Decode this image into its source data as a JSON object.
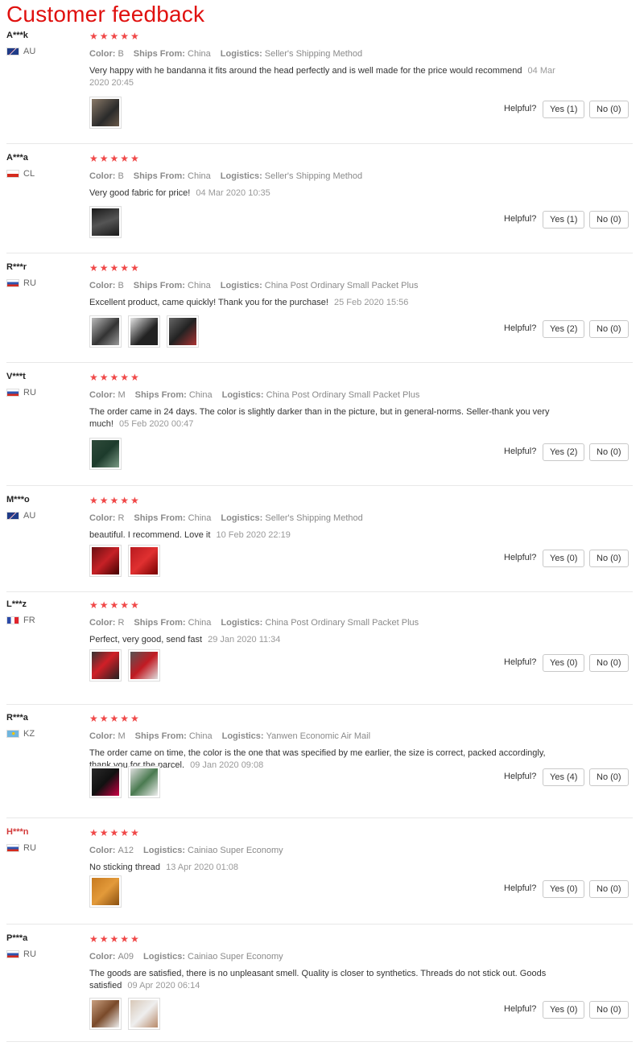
{
  "page_title": "Customer feedback",
  "labels": {
    "color": "Color:",
    "ships_from": "Ships From:",
    "logistics": "Logistics:",
    "helpful": "Helpful?",
    "star_glyphs": "★★★★★"
  },
  "colors": {
    "title": "#e0110f",
    "stars": "#f04848",
    "red_user": "#d33a3a"
  },
  "reviews": [
    {
      "user": "A***k",
      "country": "AU",
      "flag": "au",
      "stars": 5,
      "color": "B",
      "ships_from": "China",
      "logistics": "Seller's Shipping Method",
      "text": "Very happy with he bandanna it fits around the head perfectly and is well made for the price would recommend",
      "date": "04 Mar 2020 20:45",
      "yes": "Yes (1)",
      "no": "No (0)",
      "photos": 1
    },
    {
      "user": "A***a",
      "country": "CL",
      "flag": "cl",
      "stars": 5,
      "color": "B",
      "ships_from": "China",
      "logistics": "Seller's Shipping Method",
      "text": "Very good fabric for price!",
      "date": "04 Mar 2020 10:35",
      "yes": "Yes (1)",
      "no": "No (0)",
      "photos": 1
    },
    {
      "user": "R***r",
      "country": "RU",
      "flag": "ru",
      "stars": 5,
      "color": "B",
      "ships_from": "China",
      "logistics": "China Post Ordinary Small Packet Plus",
      "text": "Excellent product, came quickly! Thank you for the purchase!",
      "date": "25 Feb 2020 15:56",
      "yes": "Yes (2)",
      "no": "No (0)",
      "photos": 3
    },
    {
      "user": "V***t",
      "country": "RU",
      "flag": "ru",
      "stars": 5,
      "color": "M",
      "ships_from": "China",
      "logistics": "China Post Ordinary Small Packet Plus",
      "text": "The order came in 24 days. The color is slightly darker than in the picture, but in general-norms. Seller-thank you very much!",
      "date": "05 Feb 2020 00:47",
      "yes": "Yes (2)",
      "no": "No (0)",
      "photos": 1
    },
    {
      "user": "M***o",
      "country": "AU",
      "flag": "au",
      "stars": 5,
      "color": "R",
      "ships_from": "China",
      "logistics": "Seller's Shipping Method",
      "text": "beautiful. I recommend. Love it",
      "date": "10 Feb 2020 22:19",
      "yes": "Yes (0)",
      "no": "No (0)",
      "photos": 2
    },
    {
      "user": "L***z",
      "country": "FR",
      "flag": "fr",
      "stars": 5,
      "color": "R",
      "ships_from": "China",
      "logistics": "China Post Ordinary Small Packet Plus",
      "text": "Perfect, very good, send fast",
      "date": "29 Jan 2020 11:34",
      "yes": "Yes (0)",
      "no": "No (0)",
      "photos": 2
    },
    {
      "user": "R***a",
      "country": "KZ",
      "flag": "kz",
      "stars": 5,
      "color": "M",
      "ships_from": "China",
      "logistics": "Yanwen Economic Air Mail",
      "text": "The order came on time, the color is the one that was specified by me earlier, the size is correct, packed accordingly, thank you for the parcel.",
      "date": "09 Jan 2020 09:08",
      "yes": "Yes (4)",
      "no": "No (0)",
      "photos": 2
    },
    {
      "user": "H***n",
      "country": "RU",
      "flag": "ru",
      "stars": 5,
      "red_name": true,
      "color": "A12",
      "ships_from": null,
      "logistics": "Cainiao Super Economy",
      "text": "No sticking thread",
      "date": "13 Apr 2020 01:08",
      "yes": "Yes (0)",
      "no": "No (0)",
      "photos": 1
    },
    {
      "user": "P***a",
      "country": "RU",
      "flag": "ru",
      "stars": 5,
      "color": "A09",
      "ships_from": null,
      "logistics": "Cainiao Super Economy",
      "text": "The goods are satisfied, there is no unpleasant smell. Quality is closer to synthetics. Threads do not stick out. Goods satisfied",
      "date": "09 Apr 2020 06:14",
      "yes": "Yes (0)",
      "no": "No (0)",
      "photos": 2
    }
  ]
}
